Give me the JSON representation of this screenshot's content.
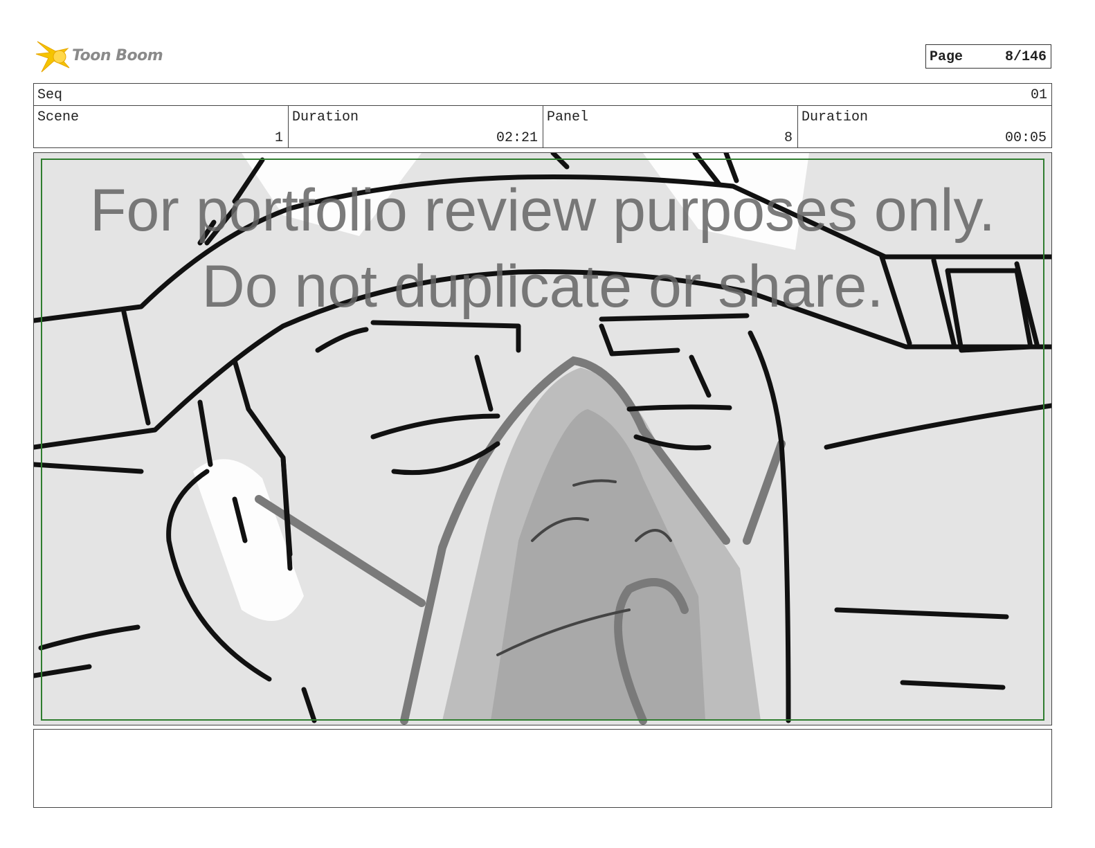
{
  "brand": {
    "name": "Toon Boom",
    "logo_icon": "starburst-logo-icon",
    "accent": "#f5c400"
  },
  "page": {
    "label": "Page",
    "value": "8/146"
  },
  "sequence": {
    "label": "Seq",
    "value": "01"
  },
  "fields": [
    {
      "label": "Scene",
      "value": "1"
    },
    {
      "label": "Duration",
      "value": "02:21"
    },
    {
      "label": "Panel",
      "value": "8"
    },
    {
      "label": "Duration",
      "value": "00:05"
    }
  ],
  "panel": {
    "watermark_line1": "For portfolio review purposes only.",
    "watermark_line2": "Do not duplicate or share.",
    "safe_frame_color": "#2f7d2f"
  },
  "notes": {
    "text": ""
  }
}
